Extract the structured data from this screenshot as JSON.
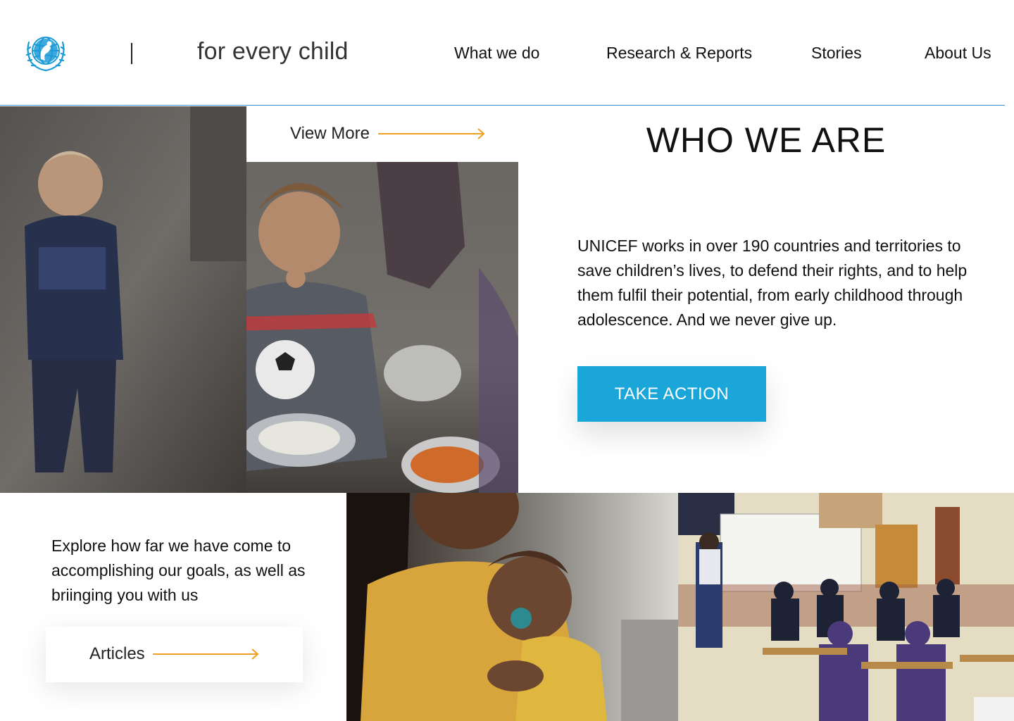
{
  "header": {
    "logo_icon": "unicef-globe-logo-icon",
    "tagline": "for every child",
    "nav": [
      {
        "label": "What we do"
      },
      {
        "label": "Research & Reports"
      },
      {
        "label": "Stories"
      },
      {
        "label": "About Us"
      }
    ],
    "accent_color": "#3a8fc8"
  },
  "view_more": {
    "label": "View More",
    "icon": "arrow-right-icon"
  },
  "who_we_are": {
    "title": "WHO WE ARE",
    "body": "UNICEF works in over 190 countries and territories to save children’s lives, to defend their rights, and to help them fulfil their potential, from early childhood through adolescence. And we never give up.",
    "cta_label": "TAKE ACTION",
    "cta_color": "#1aa6d9"
  },
  "explore": {
    "text": "Explore how far we have come to accomplishing our goals, as well as briinging you with us",
    "button_label": "Articles",
    "icon": "arrow-right-icon"
  },
  "photos": [
    {
      "name": "children-eating-photo"
    },
    {
      "name": "boy-with-plate-photo"
    },
    {
      "name": "mother-and-baby-photo"
    },
    {
      "name": "classroom-photo"
    }
  ],
  "arrow_color": "#f0a020"
}
